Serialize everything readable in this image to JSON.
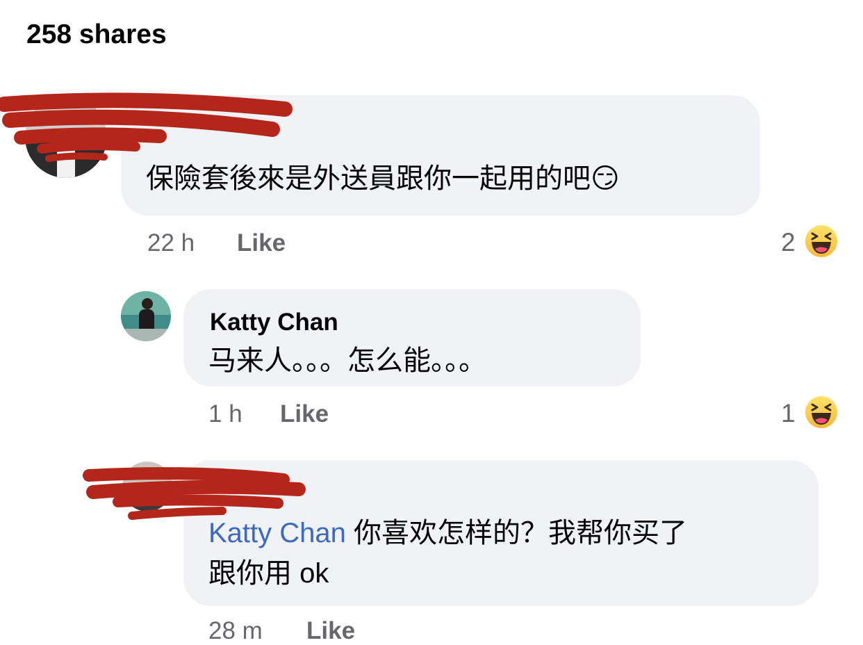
{
  "header": {
    "shares_label": "258 shares"
  },
  "comments": [
    {
      "author": "",
      "text": "保險套後來是外送員跟你一起用的吧",
      "text_emoji": "😏",
      "time": "22 h",
      "like_label": "Like",
      "reaction_count": "2",
      "reaction_icon": "haha-reaction-icon"
    },
    {
      "author": "Katty Chan",
      "text": "马来人。。。怎么能。。。",
      "time": "1 h",
      "like_label": "Like",
      "reaction_count": "1",
      "reaction_icon": "haha-reaction-icon"
    },
    {
      "author": "",
      "mention": "Katty Chan",
      "text_line1": " 你喜欢怎样的？我帮你买了",
      "text_line2": "跟你用 ok",
      "time": "28 m",
      "like_label": "Like"
    }
  ],
  "colors": {
    "bubble": "#f0f2f5",
    "mention": "#3b69c4",
    "meta": "#65676b",
    "redaction": "#b5261a"
  }
}
